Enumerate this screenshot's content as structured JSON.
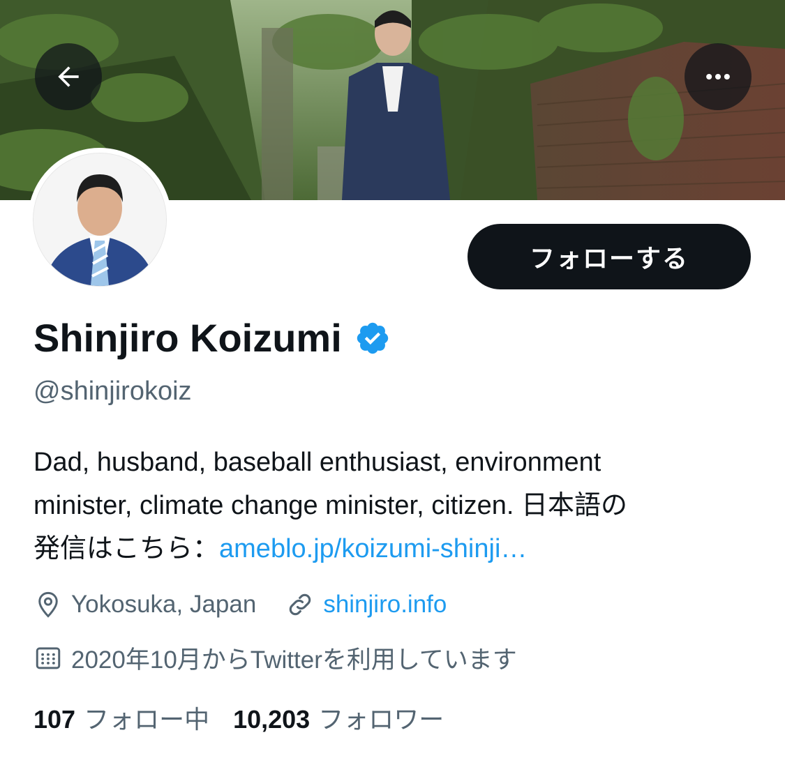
{
  "profile": {
    "name": "Shinjiro Koizumi",
    "handle": "@shinjirokoiz",
    "follow_label": "フォローする",
    "bio": {
      "line1": "Dad, husband, baseball enthusiast, environment",
      "line2": "minister, climate change minister, citizen. 日本語の",
      "line3_prefix": "発信はこちら：",
      "line3_link": "ameblo.jp/koizumi-shinji…"
    },
    "location": "Yokosuka, Japan",
    "website": "shinjiro.info",
    "joined": "2020年10月からTwitterを利用しています",
    "following_count": "107",
    "following_label": "フォロー中",
    "followers_count": "10,203",
    "followers_label": "フォロワー"
  },
  "icons": {
    "back": "arrow-left-icon",
    "more": "more-horizontal-icon",
    "verified": "verified-badge-icon",
    "location": "location-pin-icon",
    "link": "link-icon",
    "calendar": "calendar-icon"
  },
  "colors": {
    "accent": "#1d9bf0",
    "text_primary": "#0f1419",
    "text_secondary": "#536471",
    "button_bg": "#0f1419"
  }
}
